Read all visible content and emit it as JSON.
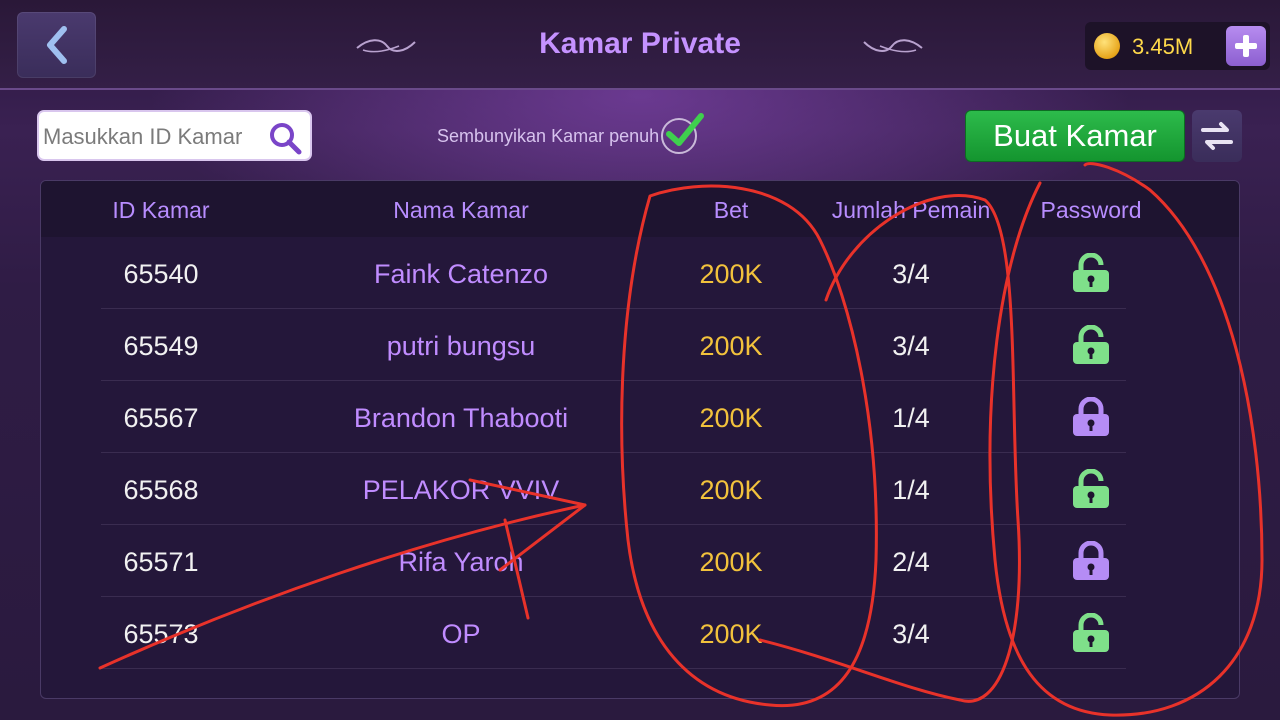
{
  "header": {
    "title": "Kamar Private",
    "back_icon": "chevron-left-icon",
    "coins": "3.45M",
    "coin_icon": "coin-icon",
    "add_icon": "plus-icon"
  },
  "toolbar": {
    "search_placeholder": "Masukkan ID Kamar",
    "search_icon": "search-icon",
    "hide_full_label": "Sembunyikan Kamar penuh",
    "hide_full_checked": true,
    "create_label": "Buat Kamar",
    "refresh_icon": "swap-icon"
  },
  "table": {
    "headers": {
      "id": "ID Kamar",
      "name": "Nama Kamar",
      "bet": "Bet",
      "players": "Jumlah Pemain",
      "password": "Password"
    },
    "rows": [
      {
        "id": "65540",
        "name": "Faink Catenzo",
        "bet": "200K",
        "players": "3/4",
        "lock": "unlocked"
      },
      {
        "id": "65549",
        "name": "putri bungsu",
        "bet": "200K",
        "players": "3/4",
        "lock": "unlocked"
      },
      {
        "id": "65567",
        "name": "Brandon Thabooti",
        "bet": "200K",
        "players": "1/4",
        "lock": "locked"
      },
      {
        "id": "65568",
        "name": "PELAKOR VVIV",
        "bet": "200K",
        "players": "1/4",
        "lock": "unlocked"
      },
      {
        "id": "65571",
        "name": "Rifa Yaroh",
        "bet": "200K",
        "players": "2/4",
        "lock": "locked"
      },
      {
        "id": "65573",
        "name": "OP",
        "bet": "200K",
        "players": "3/4",
        "lock": "unlocked"
      }
    ]
  },
  "colors": {
    "accent": "#c592ff",
    "bet": "#f2c23c",
    "unlocked": "#7fe08a",
    "locked": "#b58cf5",
    "annotation": "#e8322a"
  }
}
